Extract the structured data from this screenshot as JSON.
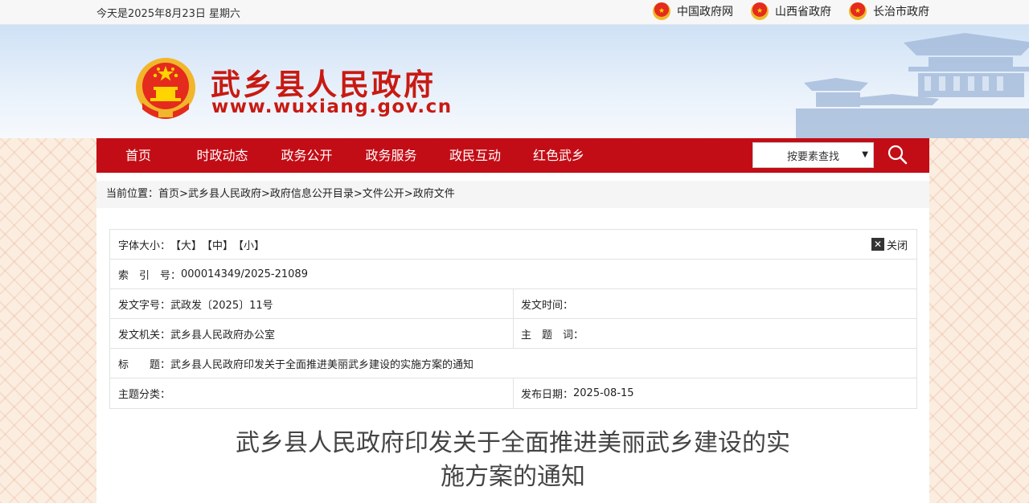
{
  "topbar": {
    "date_text": "今天是2025年8月23日 星期六",
    "links": [
      "中国政府网",
      "山西省政府",
      "长治市政府"
    ]
  },
  "header": {
    "site_name": "武乡县人民政府",
    "site_url": "www.wuxiang.gov.cn"
  },
  "nav": {
    "items": [
      "首页",
      "时政动态",
      "政务公开",
      "政务服务",
      "政民互动",
      "红色武乡"
    ],
    "search_select": "按要素查找"
  },
  "breadcrumb": {
    "prefix": "当前位置：",
    "items": [
      "首页",
      "武乡县人民政府",
      "政府信息公开目录",
      "文件公开",
      "政府文件"
    ],
    "separator": ">"
  },
  "meta": {
    "font_size_label": "字体大小：",
    "font_large": "【大】",
    "font_medium": "【中】",
    "font_small": "【小】",
    "close_label": "关闭",
    "index_label": "索　引　号：",
    "index_value": "000014349/2025-21089",
    "doc_no_label": "发文字号：",
    "doc_no_value": "武政发〔2025〕11号",
    "issue_time_label": "发文时间：",
    "issue_time_value": "",
    "issuer_label": "发文机关：",
    "issuer_value": "武乡县人民政府办公室",
    "keywords_label": "主　题　词：",
    "keywords_value": "",
    "title_label": "标　　题：",
    "title_value": "武乡县人民政府印发关于全面推进美丽武乡建设的实施方案的通知",
    "category_label": "主题分类：",
    "category_value": "",
    "publish_date_label": "发布日期：",
    "publish_date_value": "2025-08-15"
  },
  "document": {
    "title_line1": "武乡县人民政府印发关于全面推进美丽武乡建设的实",
    "title_line2": "施方案的通知"
  },
  "colors": {
    "brand_red": "#c30d16",
    "logo_red": "#c81a12",
    "banner_blue": "#cfe1f6"
  }
}
